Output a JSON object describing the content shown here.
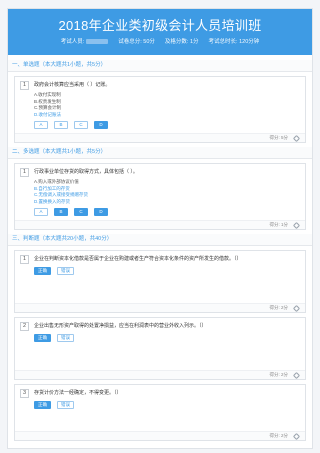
{
  "header": {
    "title": "2018年企业类初级会计人员培训班",
    "candidate_label": "考试人员:",
    "total_label": "试卷总分: 50分",
    "pass_label": "及格分数: 1分",
    "time_label": "考试总时长: 120分钟"
  },
  "sections": {
    "single": "一、单选题（本大题共1小题，共5分）",
    "multi": "二、多选题（本大题共1小题，共5分）",
    "judge": "三、判断题（本大题共20小题，共40分）"
  },
  "q1": {
    "num": "1",
    "text": "政府会计核算应当采用（ ）记账。",
    "options": [
      "A.收付实现制",
      "B.权责发生制",
      "C.预算会计制",
      "D.收付记账法"
    ],
    "buttons": [
      "A",
      "B",
      "C",
      "D"
    ],
    "score": "得分: 5分"
  },
  "q2": {
    "num": "1",
    "text": "行政事业单位存货的取得方式，具体包括（ ）。",
    "options": [
      "A.购入或外部协议价值",
      "B.自行加工的存货",
      "C.无偿调入或接受捐赠存货",
      "D.置换换入的存货"
    ],
    "buttons": [
      "A",
      "B",
      "C",
      "D"
    ],
    "score": "得分: 1分"
  },
  "q3": {
    "num": "1",
    "text": "企业在判断资本化借款是否属于企业在购建或者生产符合资本化条件的资产所发生的借款。（）",
    "buttons": [
      "正确",
      "错误"
    ],
    "score": "得分: 2分"
  },
  "q4": {
    "num": "2",
    "text": "企业出售无形资产取得的处置净损益，应当在利润表中的营业外收入列示。（）",
    "buttons": [
      "正确",
      "错误"
    ],
    "score": "得分: 2分"
  },
  "q5": {
    "num": "3",
    "text": "存货计价方法一经确定，不得变更。（）",
    "buttons": [
      "正确",
      "错误"
    ],
    "score": "得分: 2分"
  }
}
